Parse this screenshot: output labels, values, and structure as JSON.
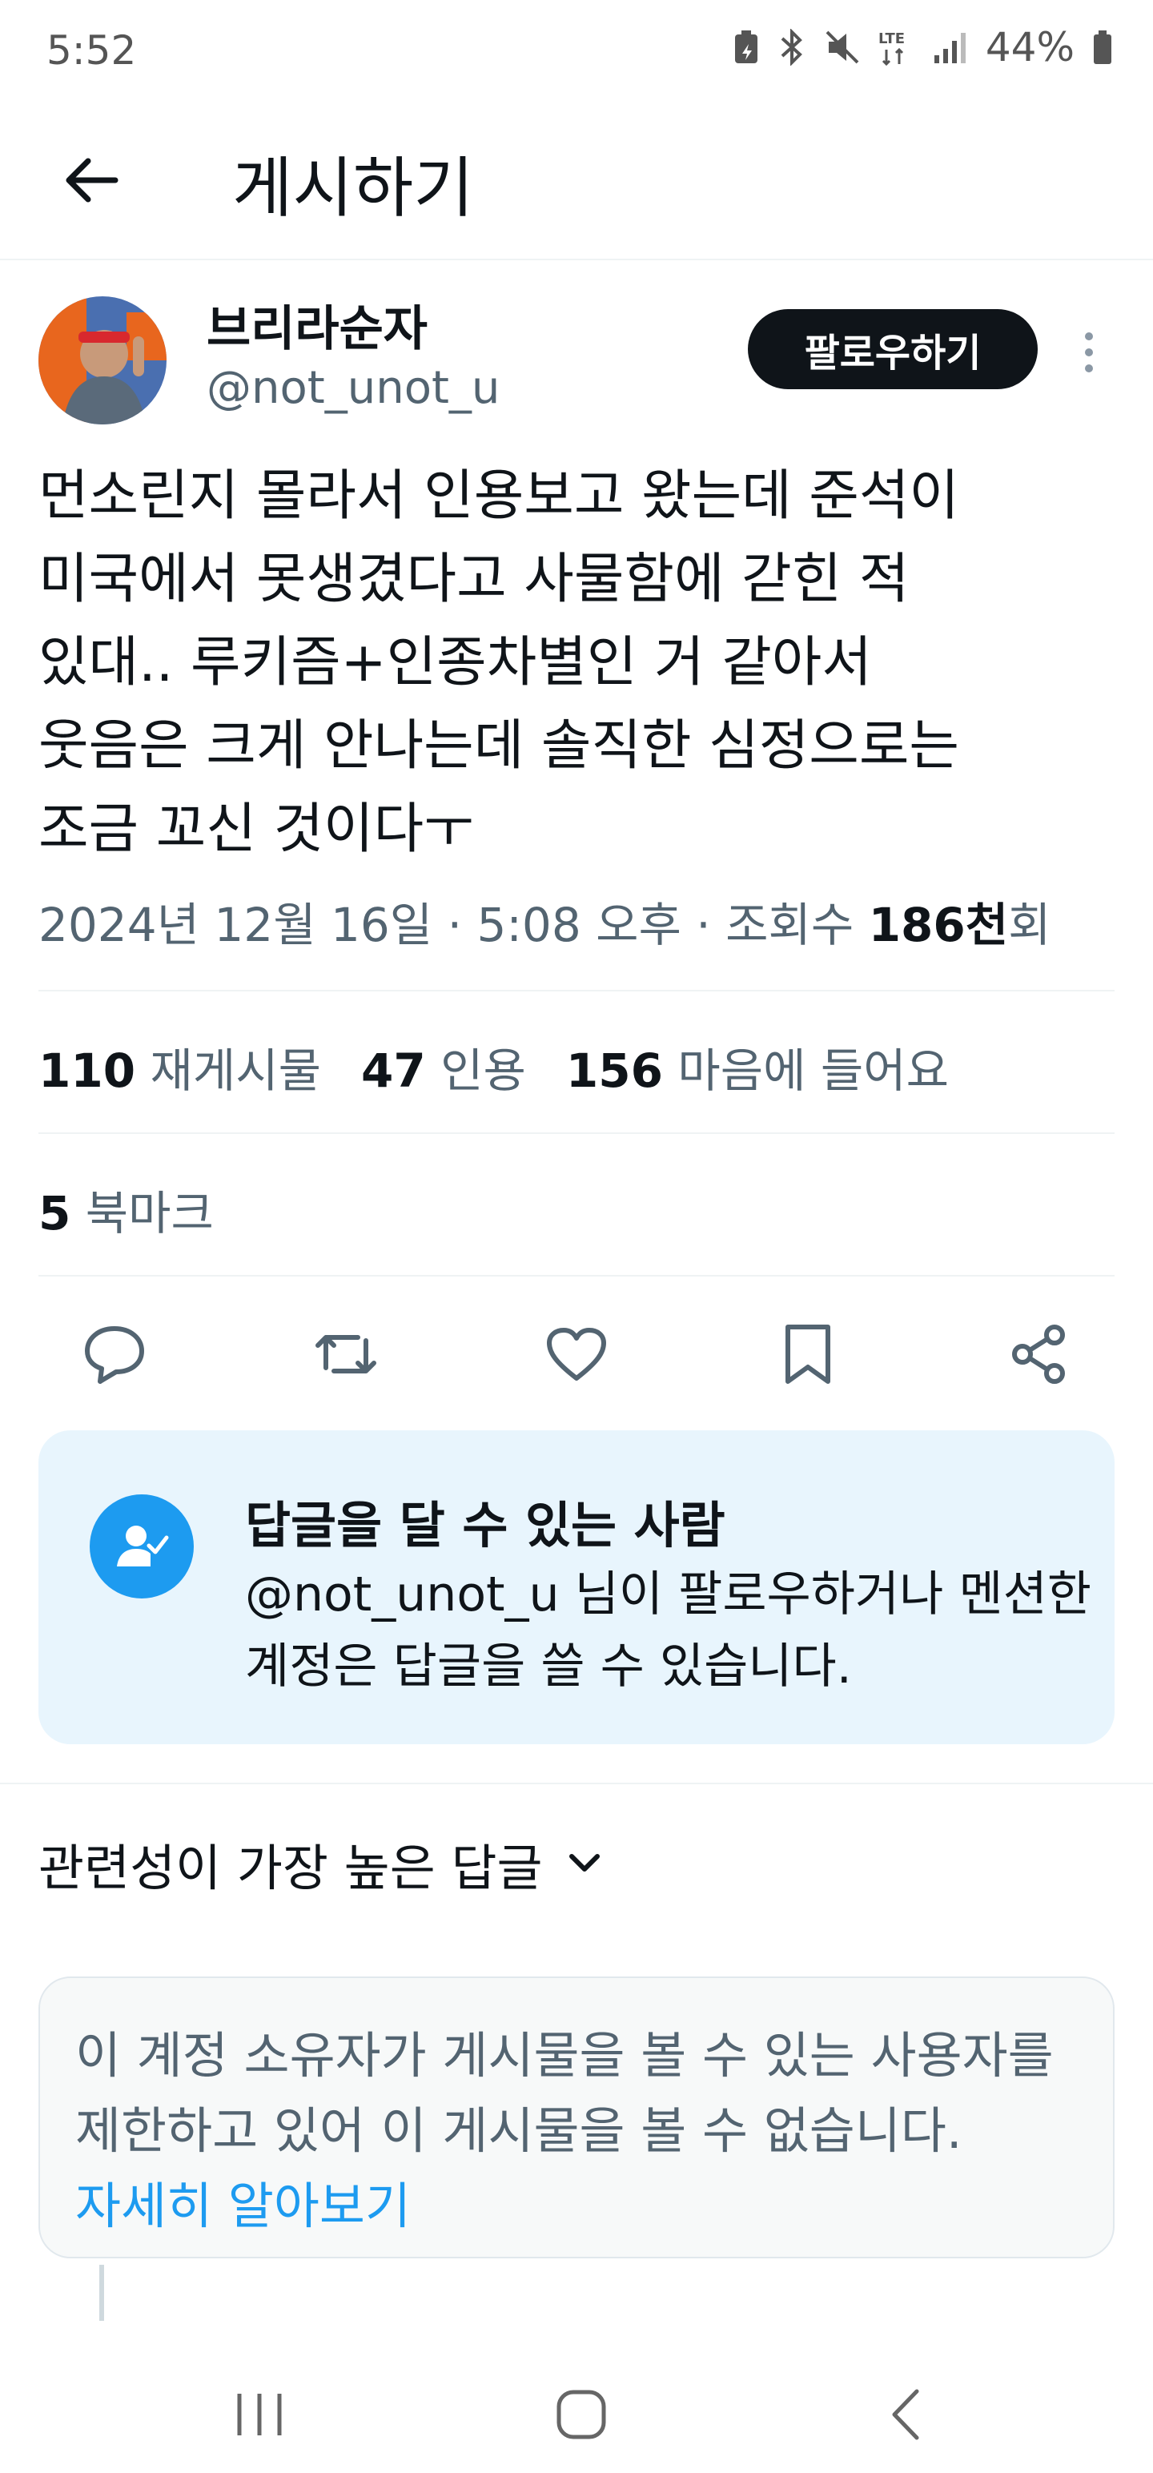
{
  "status_bar": {
    "time": "5:52",
    "battery": "44%"
  },
  "header": {
    "title": "게시하기"
  },
  "post": {
    "author_name": "브리라순자",
    "author_handle": "@not_unot_u",
    "follow_label": "팔로우하기",
    "text": "먼소린지 몰라서 인용보고 왔는데 준석이\n미국에서 못생겼다고 사물함에 갇힌 적\n있대.. 루키즘+인종차별인 거 같아서\n웃음은 크게 안나는데 솔직한 심정으로는\n조금 꼬신 것이다ㅜ",
    "meta_prefix": "2024년 12월 16일 · 5:08 오후 · 조회수 ",
    "views": "186천",
    "views_suffix": "회"
  },
  "stats": {
    "reposts_count": "110",
    "reposts_label": "재게시물",
    "quotes_count": "47",
    "quotes_label": "인용",
    "likes_count": "156",
    "likes_label": "마음에 들어요",
    "bookmarks_count": "5",
    "bookmarks_label": "북마크"
  },
  "reply_restriction": {
    "title": "답글을 달 수 있는 사람",
    "body": "@not_unot_u 님이 팔로우하거나 멘션한 계정은 답글을 쓸 수 있습니다."
  },
  "replies": {
    "sort_label": "관련성이 가장 높은 답글"
  },
  "hidden_notice": {
    "text": "이 계정 소유자가 게시물을 볼 수 있는 사용자를 제한하고 있어 이 게시물을 볼 수 없습니다.",
    "link": "자세히 알아보기"
  },
  "colors": {
    "accent": "#1d9bf0",
    "text_primary": "#0f1419",
    "text_secondary": "#536471",
    "card_blue": "#e8f5fd"
  },
  "icons": {
    "back": "arrow-left-icon",
    "more": "more-vertical-icon",
    "reply": "comment-icon",
    "repost": "repost-icon",
    "like": "heart-icon",
    "bookmark": "bookmark-icon",
    "share": "share-icon",
    "reply_permission": "person-check-icon",
    "sort": "chevron-down-icon"
  }
}
